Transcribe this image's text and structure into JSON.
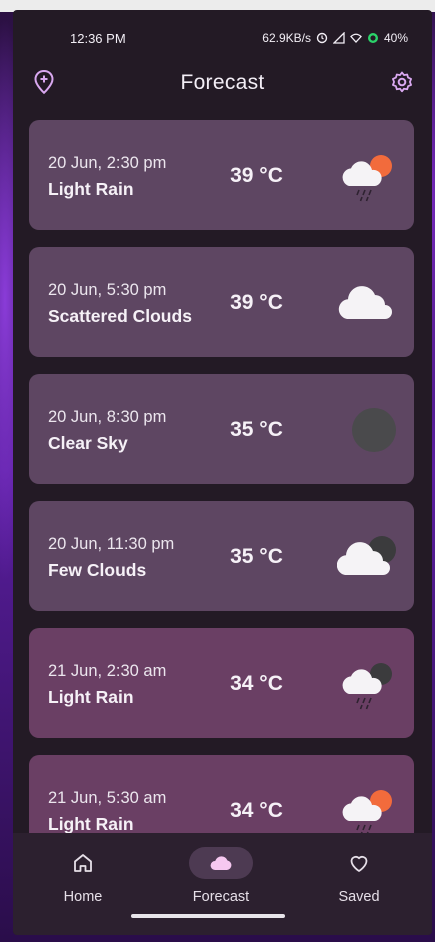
{
  "status_bar": {
    "time": "12:36 PM",
    "network_speed": "62.9KB/s",
    "battery": "40%"
  },
  "app_bar": {
    "title": "Forecast",
    "left_icon": "add-location-icon",
    "right_icon": "gear-icon"
  },
  "forecast": [
    {
      "date": "20 Jun, 2:30 pm",
      "desc": "Light Rain",
      "temp": "39 °C",
      "icon": "rain-sun-icon"
    },
    {
      "date": "20 Jun, 5:30 pm",
      "desc": "Scattered Clouds",
      "temp": "39 °C",
      "icon": "cloud-icon"
    },
    {
      "date": "20 Jun, 8:30 pm",
      "desc": "Clear Sky",
      "temp": "35 °C",
      "icon": "moon-icon"
    },
    {
      "date": "20 Jun, 11:30 pm",
      "desc": "Few Clouds",
      "temp": "35 °C",
      "icon": "cloud-moon-icon"
    },
    {
      "date": "21 Jun, 2:30 am",
      "desc": "Light Rain",
      "temp": "34 °C",
      "icon": "rain-moon-icon"
    },
    {
      "date": "21 Jun, 5:30 am",
      "desc": "Light Rain",
      "temp": "34 °C",
      "icon": "rain-sun-icon"
    }
  ],
  "nav": {
    "home": "Home",
    "forecast": "Forecast",
    "saved": "Saved"
  },
  "colors": {
    "background": "#231a25",
    "card": "#5e4662",
    "card_alt": "#6a3f64",
    "accent": "#d9a8f0",
    "sun": "#f26b3c"
  }
}
